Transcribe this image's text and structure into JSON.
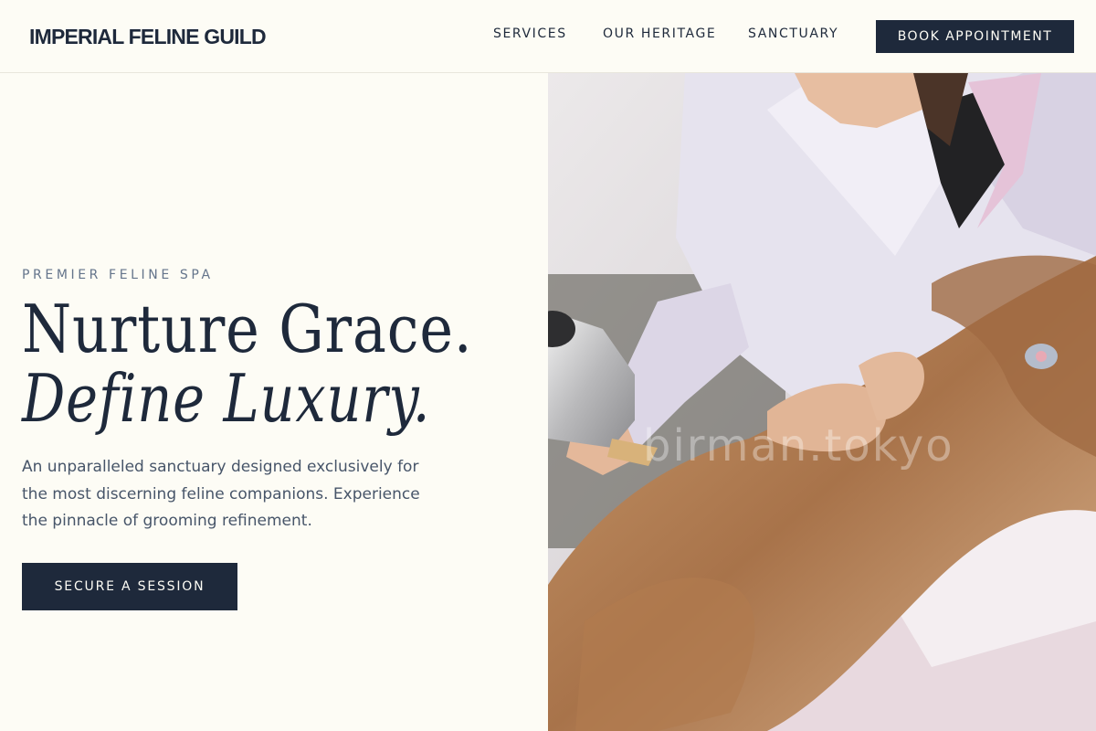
{
  "brand": {
    "name": "IMPERIAL FELINE GUILD"
  },
  "nav": {
    "items": [
      {
        "label": "SERVICES"
      },
      {
        "label": "OUR HERITAGE"
      },
      {
        "label": "SANCTUARY"
      }
    ],
    "cta_label": "BOOK APPOINTMENT"
  },
  "hero": {
    "eyebrow": "PREMIER FELINE SPA",
    "headline_line1": "Nurture Grace.",
    "headline_line2": "Define Luxury.",
    "description": "An unparalleled sanctuary designed exclusively for the most discerning feline companions. Experience the pinnacle of grooming refinement.",
    "cta_label": "SECURE A SESSION"
  },
  "image": {
    "watermark": "birman.tokyo"
  },
  "colors": {
    "background": "#fdfcf5",
    "primary": "#1e293b",
    "muted_text": "#64748b"
  }
}
